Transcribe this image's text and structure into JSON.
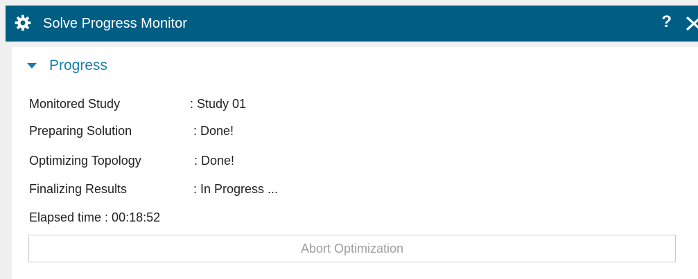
{
  "window": {
    "title": "Solve Progress Monitor",
    "help_label": "?",
    "title_bar_color": "#005d84",
    "icons": {
      "title": "gear-icon",
      "close": "close-icon",
      "section": "caret-down-icon"
    }
  },
  "progress": {
    "section_title": "Progress",
    "monitored_study": {
      "label": "Monitored Study",
      "value": ": Study 01"
    },
    "preparing_solution": {
      "label": "Preparing Solution",
      "value": ": Done!"
    },
    "optimizing_topology": {
      "label": "Optimizing Topology",
      "value": ": Done!"
    },
    "finalizing_results": {
      "label": "Finalizing Results",
      "value": ": In Progress ..."
    },
    "elapsed_time": "Elapsed time : 00:18:52",
    "abort_label": "Abort Optimization",
    "accent_color": "#1a7ea8"
  }
}
